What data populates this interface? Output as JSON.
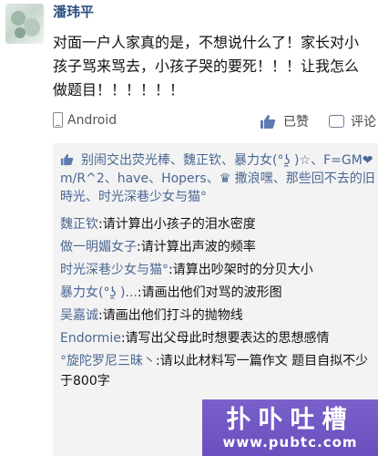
{
  "post": {
    "author": "潘玮平",
    "text": "对面一户人家真的是，不想说什么了！家长对小孩子骂来骂去，小孩子哭的要死！！！让我怎么做题目！！！！！！",
    "device": "Android",
    "like_label": "已赞",
    "comment_label": "评论"
  },
  "likers": {
    "text": "别闹交出荧光棒、魏正钦、暴力女(°ʖ̯ )☆、F=GM❤m/R^2、have、Hopers、♛ 撒浪嘿、那些回不去的旧時光、时光深巷少女与猫°"
  },
  "comments": [
    {
      "author": "魏正钦",
      "text": ":请计算出小孩子的泪水密度"
    },
    {
      "author": "做一明媚女子",
      "text": ":请计算出声波的频率"
    },
    {
      "author": "时光深巷少女与猫°",
      "text": ":请算出吵架时的分贝大小"
    },
    {
      "author": "暴力女(°ʖ̯ )...",
      "text": ":请画出他们对骂的波形图"
    },
    {
      "author": "吴嘉诚",
      "text": ":请画出他们打斗的抛物线"
    },
    {
      "author": "Endormie",
      "text": ":请写出父母此时想要表达的思想感情"
    },
    {
      "author": "°旋陀罗尼三昧丶",
      "text": ":请以此材料写一篇作文 题目自拟不少于800字"
    }
  ],
  "watermark": {
    "title": "扑卟吐槽",
    "url": "www.pubtc.com"
  },
  "colors": {
    "link": "#4a6793",
    "author": "#2f5183",
    "panel": "#f3f3f3",
    "watermark": "#6a4fbf"
  }
}
